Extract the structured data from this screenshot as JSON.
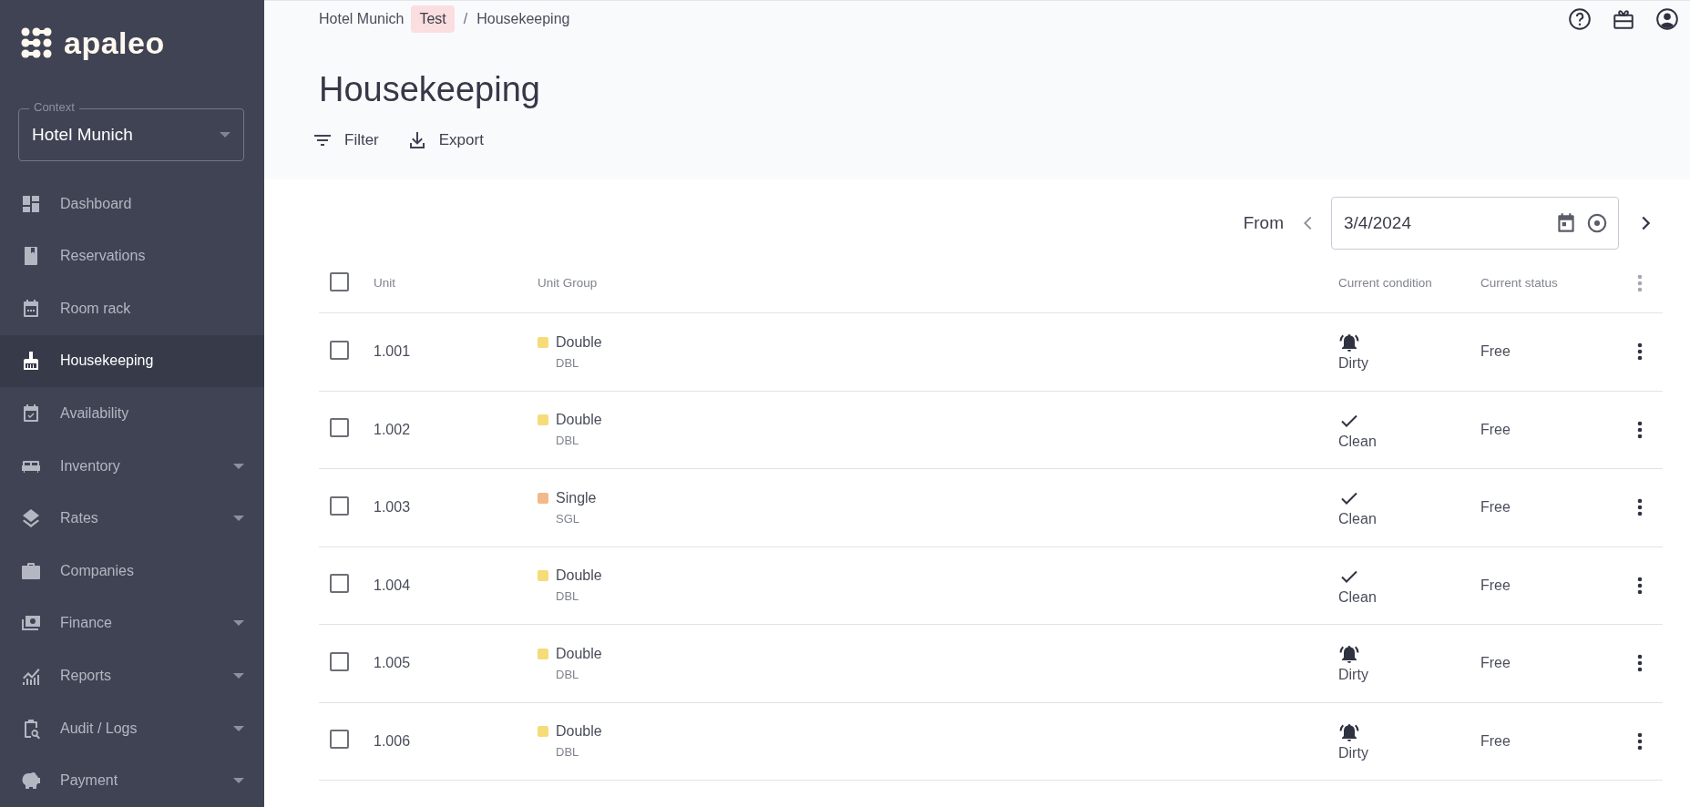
{
  "sidebar": {
    "logo": "apaleo",
    "context": {
      "label": "Context",
      "value": "Hotel Munich"
    },
    "items": [
      {
        "label": "Dashboard",
        "selected": false,
        "expandable": false
      },
      {
        "label": "Reservations",
        "selected": false,
        "expandable": false
      },
      {
        "label": "Room rack",
        "selected": false,
        "expandable": false
      },
      {
        "label": "Housekeeping",
        "selected": true,
        "expandable": false
      },
      {
        "label": "Availability",
        "selected": false,
        "expandable": false
      },
      {
        "label": "Inventory",
        "selected": false,
        "expandable": true
      },
      {
        "label": "Rates",
        "selected": false,
        "expandable": true
      },
      {
        "label": "Companies",
        "selected": false,
        "expandable": false
      },
      {
        "label": "Finance",
        "selected": false,
        "expandable": true
      },
      {
        "label": "Reports",
        "selected": false,
        "expandable": true
      },
      {
        "label": "Audit / Logs",
        "selected": false,
        "expandable": true
      },
      {
        "label": "Payment",
        "selected": false,
        "expandable": true
      }
    ]
  },
  "breadcrumb": {
    "property": "Hotel Munich",
    "badge": "Test",
    "separator": "/",
    "page": "Housekeeping"
  },
  "title": "Housekeeping",
  "actions": [
    {
      "label": "Filter"
    },
    {
      "label": "Export"
    }
  ],
  "date_filter": {
    "label": "From",
    "value": "3/4/2024"
  },
  "table": {
    "select_all_checked": false,
    "columns": [
      "Unit",
      "Unit Group",
      "Current condition",
      "Current status"
    ],
    "rows": [
      {
        "unit": "1.001",
        "group": "Double",
        "code": "DBL",
        "color": "#f5dc78",
        "condition": "Dirty",
        "kind": "dirty",
        "status": "Free",
        "checked": false
      },
      {
        "unit": "1.002",
        "group": "Double",
        "code": "DBL",
        "color": "#f5dc78",
        "condition": "Clean",
        "kind": "clean",
        "status": "Free",
        "checked": false
      },
      {
        "unit": "1.003",
        "group": "Single",
        "code": "SGL",
        "color": "#f2b98a",
        "condition": "Clean",
        "kind": "clean",
        "status": "Free",
        "checked": false
      },
      {
        "unit": "1.004",
        "group": "Double",
        "code": "DBL",
        "color": "#f5dc78",
        "condition": "Clean",
        "kind": "clean",
        "status": "Free",
        "checked": false
      },
      {
        "unit": "1.005",
        "group": "Double",
        "code": "DBL",
        "color": "#f5dc78",
        "condition": "Dirty",
        "kind": "dirty",
        "status": "Free",
        "checked": false
      },
      {
        "unit": "1.006",
        "group": "Double",
        "code": "DBL",
        "color": "#f5dc78",
        "condition": "Dirty",
        "kind": "dirty",
        "status": "Free",
        "checked": false
      }
    ]
  }
}
